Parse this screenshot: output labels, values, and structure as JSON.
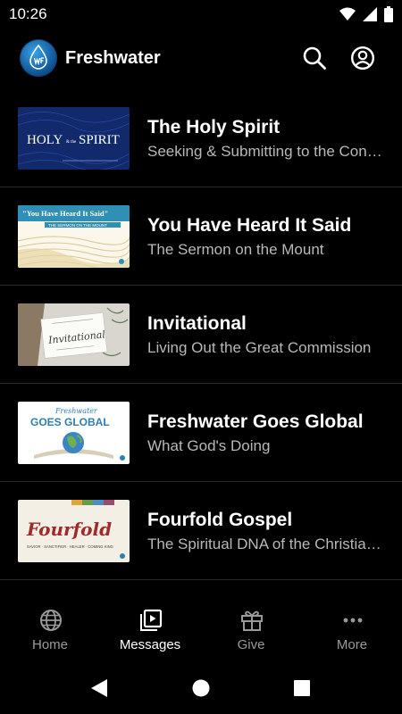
{
  "status": {
    "time": "10:26"
  },
  "app": {
    "title": "Freshwater"
  },
  "messages": [
    {
      "title": "The Holy Spirit",
      "subtitle": "Seeking & Submitting to the Con…"
    },
    {
      "title": "You Have Heard It Said",
      "subtitle": "The Sermon on the Mount"
    },
    {
      "title": "Invitational",
      "subtitle": "Living Out the Great Commission"
    },
    {
      "title": "Freshwater Goes Global",
      "subtitle": "What God's Doing"
    },
    {
      "title": "Fourfold Gospel",
      "subtitle": "The Spiritual DNA of the Christia…"
    }
  ],
  "thumbs": {
    "holy_spirit": {
      "line1": "HOLY",
      "amp": "& the",
      "line2": "SPIRIT"
    },
    "heard_it_said": {
      "title": "\"You Have Heard It Said\"",
      "banner": "THE SERMON ON THE MOUNT"
    },
    "invitational": {
      "script": "Invitational"
    },
    "goes_global": {
      "top": "Freshwater",
      "main": "GOES GLOBAL"
    },
    "fourfold": {
      "script": "Fourfold",
      "tagline": "SAVIOR · SANCTIFIER · HEALER · COMING KING"
    }
  },
  "nav": {
    "items": [
      {
        "label": "Home"
      },
      {
        "label": "Messages"
      },
      {
        "label": "Give"
      },
      {
        "label": "More"
      }
    ]
  },
  "colors": {
    "accent": "#ffffff",
    "inactive": "#9a9a9a",
    "background": "#000000"
  }
}
